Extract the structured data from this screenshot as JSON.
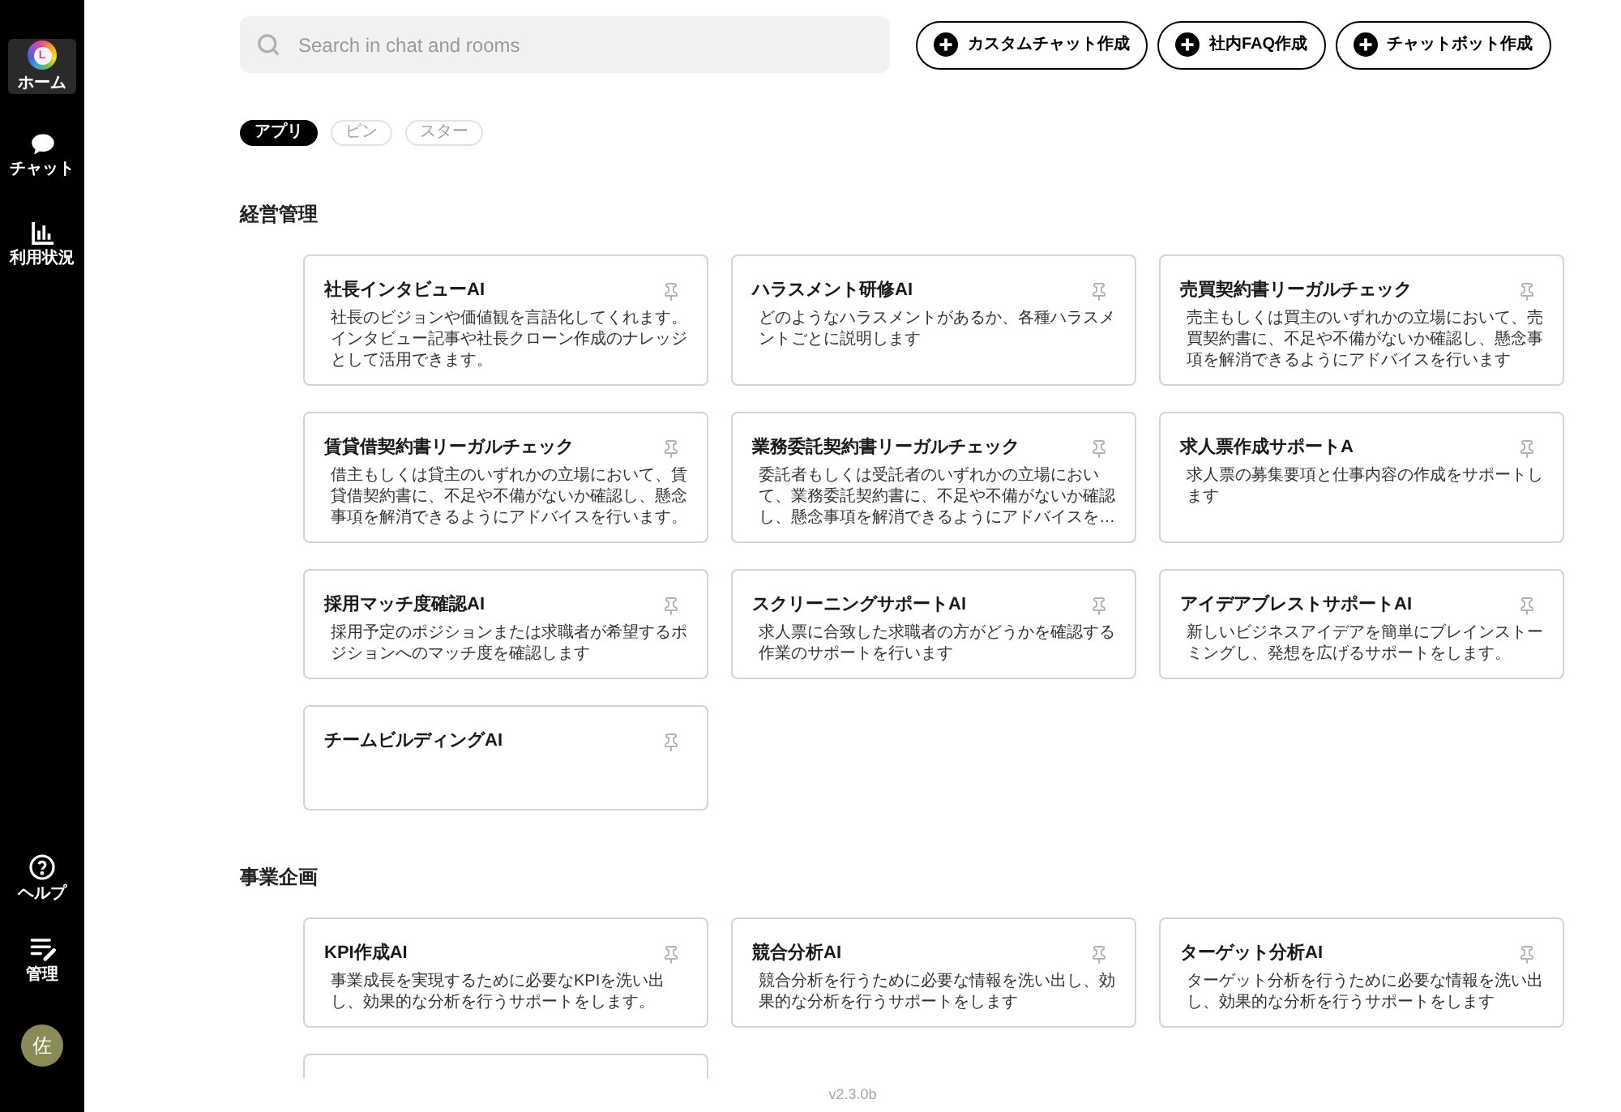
{
  "sidebar": {
    "items": [
      {
        "kind": "logo",
        "logo_text": "L",
        "label": "ホーム",
        "selected": true
      },
      {
        "kind": "chat",
        "label": "チャット",
        "selected": false
      },
      {
        "kind": "chart",
        "label": "利用状況",
        "selected": false
      }
    ],
    "bottom_items": [
      {
        "kind": "help",
        "label": "ヘルプ",
        "selected": false
      },
      {
        "kind": "manage",
        "label": "管理",
        "selected": false
      }
    ],
    "avatar": {
      "text": "佐"
    }
  },
  "search": {
    "placeholder": "Search in chat and rooms"
  },
  "actions": [
    {
      "label": "カスタムチャット作成"
    },
    {
      "label": "社内FAQ作成"
    },
    {
      "label": "チャットボット作成"
    }
  ],
  "filters": [
    {
      "label": "アプリ",
      "selected": true
    },
    {
      "label": "ピン",
      "selected": false
    },
    {
      "label": "スター",
      "selected": false
    }
  ],
  "sections": [
    {
      "title": "経営管理",
      "cards": [
        {
          "kind": "app",
          "title": "社長インタビューAI",
          "description": "社長のビジョンや価値観を言語化してくれます。インタビュー記事や社長クローン作成のナレッジとして活用できます。"
        },
        {
          "kind": "app",
          "title": "ハラスメント研修AI",
          "description": "どのようなハラスメントがあるか、各種ハラスメントごとに説明します"
        },
        {
          "kind": "app",
          "title": "売買契約書リーガルチェック",
          "description": "売主もしくは買主のいずれかの立場において、売買契約書に、不足や不備がないか確認し、懸念事項を解消できるようにアドバイスを行います"
        },
        {
          "kind": "app",
          "title": "賃貸借契約書リーガルチェック",
          "description": "借主もしくは貸主のいずれかの立場において、賃貸借契約書に、不足や不備がないか確認し、懸念事項を解消できるようにアドバイスを行います。"
        },
        {
          "kind": "app",
          "title": "業務委託契約書リーガルチェック",
          "description": "委託者もしくは受託者のいずれかの立場において、業務委託契約書に、不足や不備がないか確認し、懸念事項を解消できるようにアドバイスを…"
        },
        {
          "kind": "app",
          "title": "求人票作成サポートA",
          "description": "求人票の募集要項と仕事内容の作成をサポートします"
        },
        {
          "kind": "app",
          "title": "採用マッチ度確認AI",
          "description": "採用予定のポジションまたは求職者が希望するポジションへのマッチ度を確認します"
        },
        {
          "kind": "app",
          "title": "スクリーニングサポートAI",
          "description": "求人票に合致した求職者の方がどうかを確認する作業のサポートを行います"
        },
        {
          "kind": "app",
          "title": "アイデアブレストサポートAI",
          "description": "新しいビジネスアイデアを簡単にブレインストーミングし、発想を広げるサポートをします。"
        },
        {
          "kind": "app",
          "title": "チームビルディングAI"
        }
      ]
    },
    {
      "title": "事業企画",
      "cards": [
        {
          "kind": "app",
          "title": "KPI作成AI",
          "description": "事業成長を実現するために必要なKPIを洗い出し、効果的な分析を行うサポートをします。"
        },
        {
          "kind": "app",
          "title": "競合分析AI",
          "description": "競合分析を行うために必要な情報を洗い出し、効果的な分析を行うサポートをします"
        },
        {
          "kind": "app",
          "title": "ターゲット分析AI",
          "description": "ターゲット分析を行うために必要な情報を洗い出し、効果的な分析を行うサポートをします"
        },
        {
          "kind": "partial"
        }
      ]
    }
  ],
  "version": "v2.3.0b"
}
